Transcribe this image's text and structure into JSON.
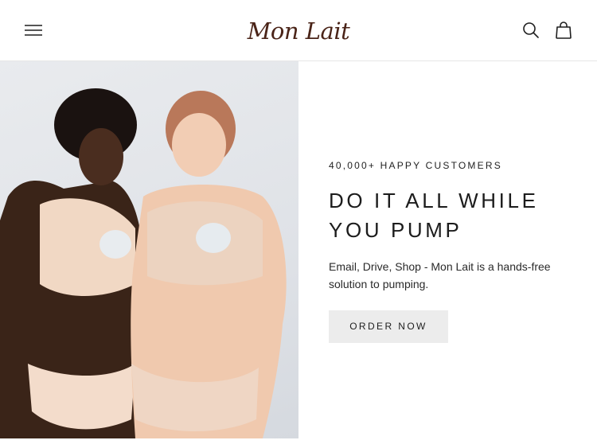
{
  "header": {
    "brand": "Mon Lait",
    "menu_icon": "hamburger-menu-icon",
    "search_icon": "search-icon",
    "cart_icon": "shopping-bag-icon"
  },
  "hero": {
    "eyebrow": "40,000+ HAPPY CUSTOMERS",
    "headline_line1": "DO IT ALL WHILE",
    "headline_line2": "YOU PUMP",
    "description": "Email, Drive, Shop - Mon Lait is a hands-free solution to pumping.",
    "cta_label": "ORDER NOW"
  },
  "colors": {
    "brand": "#4a2418",
    "cta_background": "#ececec",
    "text": "#1f1f1f"
  }
}
